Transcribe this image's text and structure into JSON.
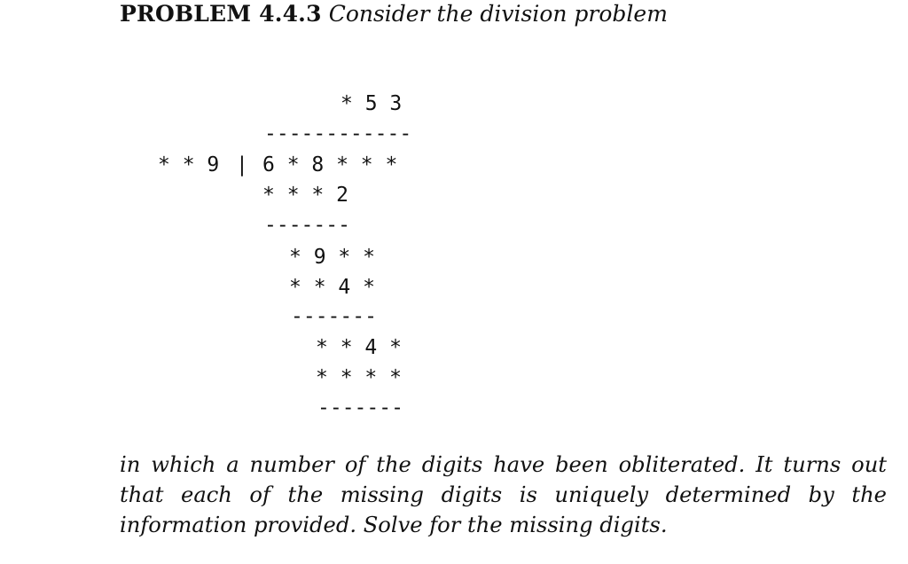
{
  "problem": {
    "label": "PROBLEM 4.4.3",
    "intro": "Consider the division problem"
  },
  "division": {
    "quotient": "* 5 3",
    "rule_top": "------------",
    "divisor": "* * 9",
    "bar": "|",
    "dividend": "6 * 8 * * *",
    "step1_product": "* * * 2",
    "rule_1": "-------",
    "step1_remainder": "* 9 * *",
    "step2_product": "* * 4 *",
    "rule_2": "-------",
    "step2_remainder": "* * 4 *",
    "step3_product": "* * * *",
    "rule_3": "-------"
  },
  "body_text": "in which a number of the digits have been obliterated. It turns out that each of the missing digits is uniquely determined by the information provided. Solve for the missing digits."
}
